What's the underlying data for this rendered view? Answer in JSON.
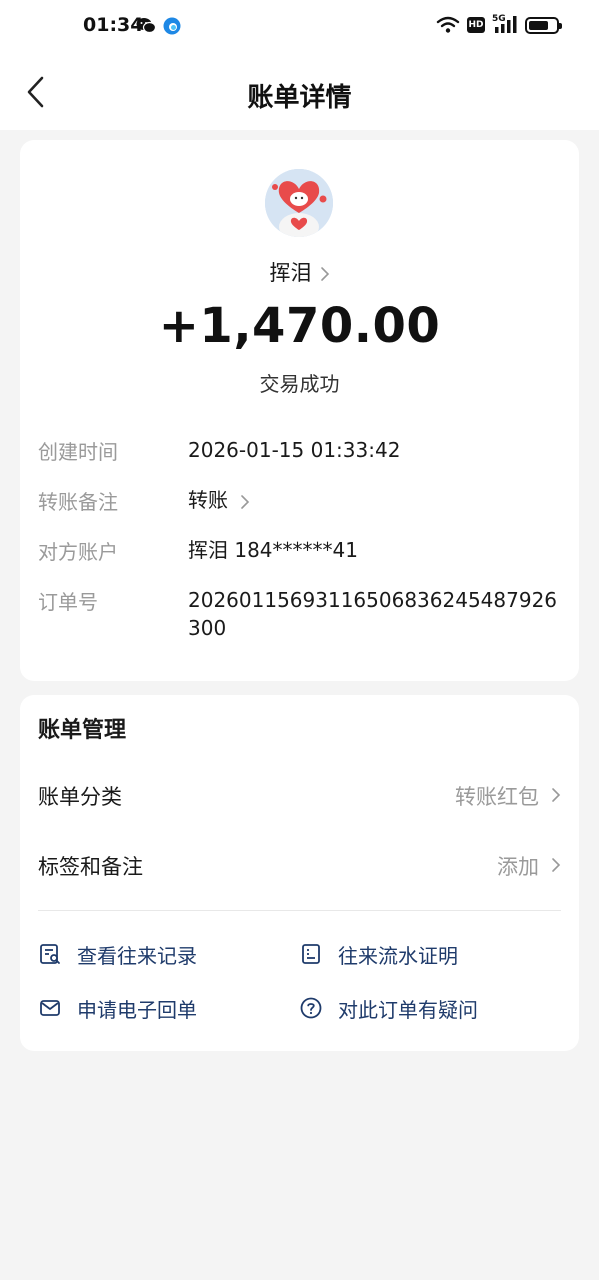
{
  "status_bar": {
    "time": "01:34",
    "network": "5G",
    "hd": "HD",
    "battery_level": 0.72
  },
  "header": {
    "title": "账单详情"
  },
  "transaction": {
    "payee_name": "挥泪",
    "amount": "+1,470.00",
    "status": "交易成功",
    "details": [
      {
        "label": "创建时间",
        "value": "2026-01-15 01:33:42"
      },
      {
        "label": "转账备注",
        "value": "转账"
      },
      {
        "label": "对方账户",
        "value": "挥泪 184******41"
      },
      {
        "label": "订单号",
        "value": "20260115693116506836245487926300"
      }
    ]
  },
  "bill_management": {
    "title": "账单管理",
    "rows": [
      {
        "label": "账单分类",
        "value": "转账红包"
      },
      {
        "label": "标签和备注",
        "value": "添加"
      }
    ],
    "actions": [
      {
        "label": "查看往来记录",
        "icon": "records-icon"
      },
      {
        "label": "往来流水证明",
        "icon": "statement-icon"
      },
      {
        "label": "申请电子回单",
        "icon": "mail-icon"
      },
      {
        "label": "对此订单有疑问",
        "icon": "question-icon"
      }
    ]
  },
  "colors": {
    "accent": "#1f3b6b",
    "muted": "#9a9a9a",
    "background": "#f4f4f4"
  }
}
